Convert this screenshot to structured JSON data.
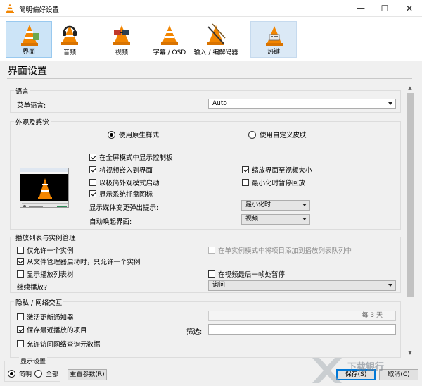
{
  "window": {
    "title": "简明偏好设置",
    "controls": {
      "minimize": "—",
      "maximize": "☐",
      "close": "✕"
    }
  },
  "categories": [
    {
      "label": "界面",
      "icon": "interface-cone-icon",
      "state": "selected"
    },
    {
      "label": "音频",
      "icon": "headphones-cone-icon",
      "state": "normal"
    },
    {
      "label": "视频",
      "icon": "glasses-cone-icon",
      "state": "normal"
    },
    {
      "label": "字幕 / OSD",
      "icon": "subtitles-cone-icon",
      "state": "normal"
    },
    {
      "label": "输入 / 编解码器",
      "icon": "input-codecs-cone-icon",
      "state": "normal"
    },
    {
      "label": "热键",
      "icon": "hotkeys-cone-icon",
      "state": "hover"
    }
  ],
  "page_title": "界面设置",
  "language": {
    "group_title": "语言",
    "menu_language_label": "菜单语言:",
    "menu_language_value": "Auto"
  },
  "look": {
    "group_title": "外观及感觉",
    "native_style": {
      "label": "使用原生样式",
      "selected": true
    },
    "custom_skin": {
      "label": "使用自定义皮肤",
      "selected": false
    },
    "fullscreen_controller": {
      "label": "在全屏模式中显示控制板",
      "checked": true
    },
    "embed_video": {
      "label": "将视频嵌入到界面",
      "checked": true
    },
    "resize_interface": {
      "label": "缩放界面至视频大小",
      "checked": true
    },
    "minimal_start": {
      "label": "以极简外观模式启动",
      "checked": false
    },
    "pause_minimized": {
      "label": "最小化时暂停回放",
      "checked": false
    },
    "systray": {
      "label": "显示系统托盘图标",
      "checked": true
    },
    "popup_label": "显示媒体变更弹出提示:",
    "popup_value": "最小化时",
    "raise_label": "自动唤起界面:",
    "raise_value": "视频"
  },
  "playlist": {
    "group_title": "播放列表与实例管理",
    "one_instance": {
      "label": "仅允许一个实例",
      "checked": false
    },
    "enqueue": {
      "label": "在单实例模式中将项目添加到播放列表队列中",
      "checked": false,
      "disabled": true
    },
    "file_manager": {
      "label": "从文件管理器启动时，只允许一个实例",
      "checked": true
    },
    "playlist_tree": {
      "label": "显示播放列表树",
      "checked": false
    },
    "pause_last_frame": {
      "label": "在视频最后一帧处暂停",
      "checked": false
    },
    "continue_label": "继续播放?",
    "continue_value": "询问"
  },
  "privacy": {
    "group_title": "隐私 / 网络交互",
    "update_notify": {
      "label": "激活更新通知器",
      "checked": false
    },
    "update_days": "每 3 天",
    "save_recent": {
      "label": "保存最近播放的项目",
      "checked": true
    },
    "filter_label": "筛选:",
    "filter_value": "",
    "metadata": {
      "label": "允许访问网络查询元数据",
      "checked": false
    }
  },
  "footer": {
    "show_settings": "显示设置",
    "simple": {
      "label": "简明",
      "selected": true
    },
    "all": {
      "label": "全部",
      "selected": false
    },
    "reset_button": "重置参数(R)",
    "save_button": "保存(S)",
    "cancel_button": "取消(C)",
    "watermark": "下载银行"
  }
}
